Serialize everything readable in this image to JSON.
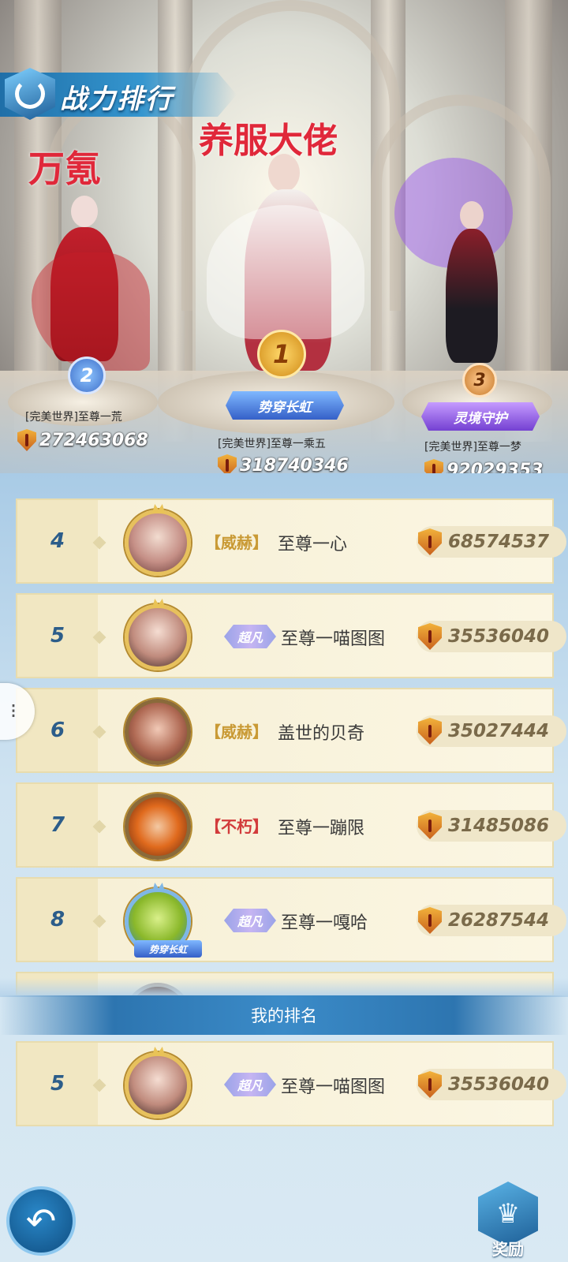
{
  "header": {
    "title": "战力排行",
    "annotation_left": "万氪",
    "annotation_center": "养服大佬"
  },
  "podium": [
    {
      "rank": "1",
      "title": "势穿长虹",
      "name": "[完美世界]至尊一乘五",
      "power": "318740346"
    },
    {
      "rank": "2",
      "title": "",
      "name": "[完美世界]至尊一荒",
      "power": "272463068"
    },
    {
      "rank": "3",
      "title": "灵境守护",
      "name": "[完美世界]至尊一梦",
      "power": "92029353"
    }
  ],
  "ranking": [
    {
      "rank": "4",
      "tag": "【威赫】",
      "tag_type": "bracket-gold",
      "name": "至尊一心",
      "power": "68574537"
    },
    {
      "rank": "5",
      "tag": "超凡",
      "tag_type": "wing",
      "name": "至尊一喵图图",
      "power": "35536040"
    },
    {
      "rank": "6",
      "tag": "【威赫】",
      "tag_type": "bracket-gold",
      "name": "盖世的贝奇",
      "power": "35027444"
    },
    {
      "rank": "7",
      "tag": "【不朽】",
      "tag_type": "bracket-red",
      "name": "至尊一蹦限",
      "power": "31485086"
    },
    {
      "rank": "8",
      "tag": "超凡",
      "tag_type": "wing",
      "name": "至尊一嘎哈",
      "power": "26287544",
      "avatar_badge": "势穿长虹"
    }
  ],
  "my_rank": {
    "label": "我的排名",
    "rank": "5",
    "tag": "超凡",
    "name": "至尊一喵图图",
    "power": "35536040"
  },
  "buttons": {
    "back_icon": "↶",
    "reward_label": "奖励",
    "float_icon": "⁝"
  },
  "colors": {
    "accent_blue": "#2d75b0",
    "row_bg": "#f6efd4",
    "annotation_red": "#e0283a",
    "power_shield": "#e08a2a"
  }
}
